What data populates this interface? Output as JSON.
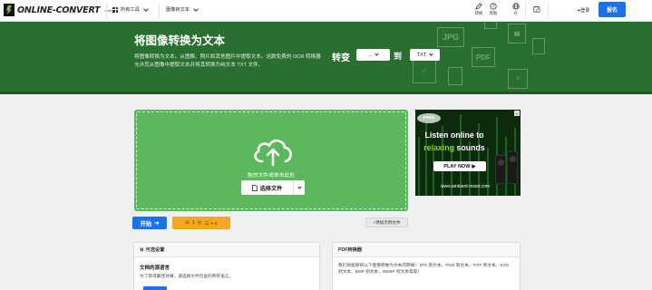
{
  "navbar": {
    "logo_text": "ONLINE-CONVERT",
    "logo_tld": ".com",
    "all_tools": "所有工具",
    "current_tool": "图像转文本",
    "icons": [
      {
        "icon": "pencil-icon",
        "label": "转换"
      },
      {
        "icon": "help-icon",
        "label": "帮助"
      },
      {
        "icon": "globe-icon",
        "label": "在"
      },
      {
        "icon": "history-icon",
        "label": ""
      }
    ],
    "login": "登录",
    "signup": "报名"
  },
  "hero": {
    "title": "将图像转换为文本",
    "description": "将图像转换为文本。从图像、照片和其他图片中提取文本。这款免费的 OCR 转换器允许您从图像中提取文本并将其转换为纯文本 TXT 文件。",
    "convert_label": "转变",
    "from_value": "...",
    "to_label": "到",
    "to_value": "TXT",
    "decor_labels": [
      "JPG",
      "PDF"
    ]
  },
  "uploader": {
    "drop_text": "拖放文件或单击此处",
    "choose_button": "选择文件"
  },
  "ad": {
    "badge": "FREE",
    "line1": "Listen online to",
    "line2_green": "relaxing",
    "line2_rest": " sounds",
    "play": "PLAY NOW",
    "url": "www.ambient-mixer.com"
  },
  "actions": {
    "start": "开始",
    "files_count": "1",
    "options_label": "三 + ≡",
    "add_example": "+添加示例文件"
  },
  "panels": {
    "optional_settings": {
      "title": "可选设置",
      "heading": "文档的源语言",
      "text": "为了获得最佳效果，请选择文件包含的所有语言。"
    },
    "pdf_converter": {
      "title": "PDF转换器",
      "text": "我们将能够将以下图像转换为文本的转换：JPG 到文本、PNG 到文本、TIFF 到文本、SVG 到文本、BMP 到文本、WEBP 到文本等等！"
    }
  },
  "colors": {
    "hero_green": "#2a6f2f",
    "upload_green": "#5cb85c",
    "primary_blue": "#1a73e8",
    "options_orange": "#f5a623"
  }
}
